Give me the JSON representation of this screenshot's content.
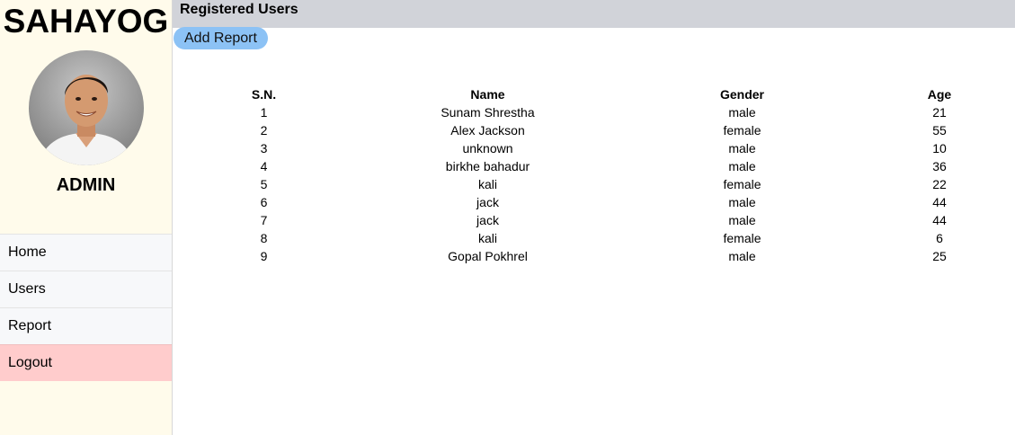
{
  "sidebar": {
    "brand": "SAHAYOG",
    "role": "ADMIN",
    "avatar_icon": "user-avatar-icon",
    "nav": {
      "home": "Home",
      "users": "Users",
      "report": "Report",
      "logout": "Logout"
    },
    "colors": {
      "background": "#fffbeb",
      "nav_item": "#f7f8fa",
      "logout": "#ffcccc"
    }
  },
  "header": {
    "title": "Registered Users",
    "background": "#d1d3d9"
  },
  "toolbar": {
    "add_report_label": "Add Report",
    "button_color": "#8cc2f5"
  },
  "table": {
    "headers": {
      "sn": "S.N.",
      "name": "Name",
      "gender": "Gender",
      "age": "Age"
    },
    "rows": [
      {
        "sn": "1",
        "name": "Sunam Shrestha",
        "gender": "male",
        "age": "21"
      },
      {
        "sn": "2",
        "name": "Alex Jackson",
        "gender": "female",
        "age": "55"
      },
      {
        "sn": "3",
        "name": "unknown",
        "gender": "male",
        "age": "10"
      },
      {
        "sn": "4",
        "name": "birkhe bahadur",
        "gender": "male",
        "age": "36"
      },
      {
        "sn": "5",
        "name": "kali",
        "gender": "female",
        "age": "22"
      },
      {
        "sn": "6",
        "name": "jack",
        "gender": "male",
        "age": "44"
      },
      {
        "sn": "7",
        "name": "jack",
        "gender": "male",
        "age": "44"
      },
      {
        "sn": "8",
        "name": "kali",
        "gender": "female",
        "age": "6"
      },
      {
        "sn": "9",
        "name": "Gopal Pokhrel",
        "gender": "male",
        "age": "25"
      }
    ]
  }
}
